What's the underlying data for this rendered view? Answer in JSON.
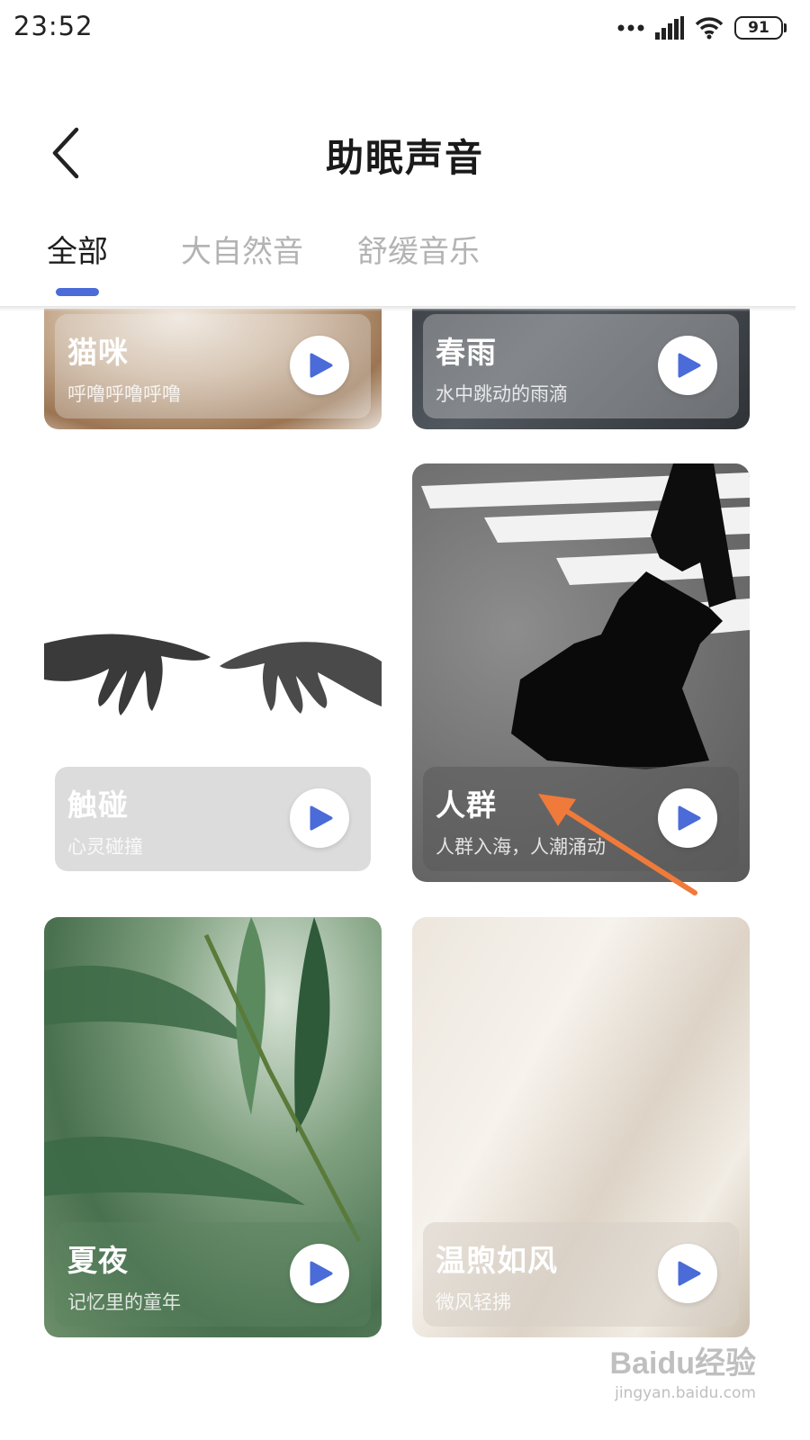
{
  "status_bar": {
    "time": "23:52",
    "battery": "91",
    "icons": [
      "dots-icon",
      "signal-icon",
      "wifi-icon",
      "battery-icon"
    ]
  },
  "header": {
    "title": "助眠声音",
    "back_icon": "chevron-left-icon"
  },
  "tabs": [
    {
      "label": "全部",
      "active": true
    },
    {
      "label": "大自然音",
      "active": false
    },
    {
      "label": "舒缓音乐",
      "active": false
    }
  ],
  "colors": {
    "accent": "#4A6BD8",
    "annotation_arrow": "#F07A3A"
  },
  "cards": [
    {
      "title": "猫咪",
      "subtitle": "呼噜呼噜呼噜"
    },
    {
      "title": "春雨",
      "subtitle": "水中跳动的雨滴"
    },
    {
      "title": "触碰",
      "subtitle": "心灵碰撞"
    },
    {
      "title": "人群",
      "subtitle": "人群入海，人潮涌动"
    },
    {
      "title": "夏夜",
      "subtitle": "记忆里的童年"
    },
    {
      "title": "温煦如风",
      "subtitle": "微风轻拂"
    }
  ],
  "watermark": {
    "logo": "Baidu经验",
    "url": "jingyan.baidu.com"
  }
}
